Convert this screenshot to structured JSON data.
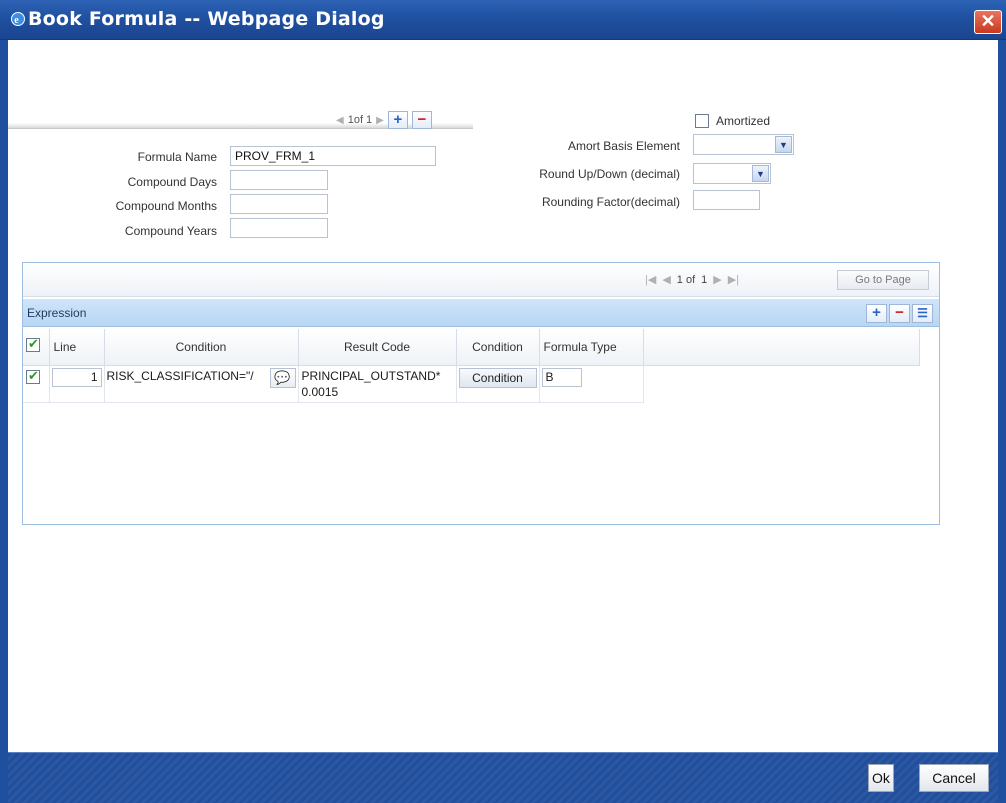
{
  "window": {
    "title": "Book Formula -- Webpage Dialog",
    "close_symbol": "✕"
  },
  "header": {
    "pager_text": "1of 1",
    "fields": {
      "formula_name_label": "Formula Name",
      "formula_name_value": "PROV_FRM_1",
      "compound_days_label": "Compound Days",
      "compound_days_value": "",
      "compound_months_label": "Compound Months",
      "compound_months_value": "",
      "compound_years_label": "Compound Years",
      "compound_years_value": ""
    },
    "right_fields": {
      "amortized_label": "Amortized",
      "amortized_checked": false,
      "amort_basis_label": "Amort Basis Element",
      "amort_basis_value": "",
      "round_label": "Round Up/Down (decimal)",
      "round_value": "",
      "rounding_factor_label": "Rounding Factor(decimal)",
      "rounding_factor_value": ""
    }
  },
  "grid": {
    "pager": {
      "of_label": "1 of",
      "total": "1",
      "goto_label": "Go to Page"
    },
    "section_title": "Expression",
    "columns": [
      "Line",
      "Condition",
      "Result Code",
      "Condition",
      "Formula Type"
    ],
    "rows": [
      {
        "line": "1",
        "condition": "RISK_CLASSIFICATION=\"/",
        "result_code_line1": "PRINCIPAL_OUTSTAND*",
        "result_code_line2": "0.0015",
        "condition_button": "Condition",
        "formula_type": "B"
      }
    ]
  },
  "footer": {
    "ok_label": "Ok",
    "cancel_label": "Cancel"
  },
  "colors": {
    "titlebar": "#1f4f9f",
    "footer": "#234f9a",
    "accent_blue": "#2a63c9",
    "delete_red": "#d01a1a"
  }
}
